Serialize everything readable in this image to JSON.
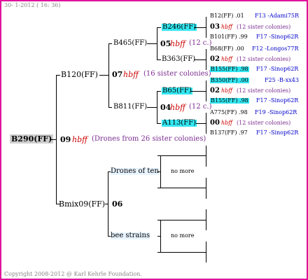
{
  "header": {
    "date": "30- 1-2012 ( 16: 36)"
  },
  "footer": {
    "copyright": "Copyright 2008-2012 @ Karl Kehrle Foundation."
  },
  "root": {
    "name": "B290(FF)",
    "num": "09",
    "hbff": "hbff",
    "desc": "(Drones from 26 sister colonies)"
  },
  "g1_top": {
    "name": "B120(FF)",
    "num": "07",
    "hbff": "hbff",
    "desc": "(16 sister colonies)"
  },
  "g1_bottom": {
    "name": "Bmix09(FF)",
    "num": "06"
  },
  "g2": {
    "a": "B465(FF)",
    "a_num": "05",
    "a_hbff": "hbff",
    "a_desc": "(12 c.)",
    "b": "B811(FF)",
    "b_num": "04",
    "b_hbff": "hbff",
    "b_desc": "(12 c.)",
    "drones_of_ten": "Drones of ten",
    "bee_strains": "bee strains",
    "no_more_1": "no more",
    "no_more_2": "no more"
  },
  "g3": {
    "a": "B246(FF)",
    "b": "B363(FF)",
    "c": "B65(FF)",
    "d": "A113(FF)"
  },
  "g4": [
    {
      "l1": "B12(FF) .01",
      "l1b": "F13 -Adami75R",
      "num": "03",
      "hbff": "hbff",
      "desc": "(12 sister colonies)",
      "l3": "B101(FF) .99",
      "l3b": "F17 -Sinop62R"
    },
    {
      "l1": "B68(FF) .00",
      "l1b": "F12 -Longos77R",
      "num": "02",
      "hbff": "hbff",
      "desc": "(12 sister colonies)",
      "l3": "B155(FF) .98",
      "l3b": "F17 -Sinop62R"
    },
    {
      "l1": "B350(FF) .00",
      "l1b": "F25 -B-xx43",
      "num": "02",
      "hbff": "hbff",
      "desc": "(12 sister colonies)",
      "l3": "B155(FF) .98",
      "l3b": "F17 -Sinop62R"
    },
    {
      "l1": "A775(FF) .98",
      "l1b": "F19 -Sinop62R",
      "num": "00",
      "hbff": "hbff",
      "desc": "(12 sister colonies)",
      "l3": "B137(FF) .97",
      "l3b": "F17 -Sinop62R"
    }
  ]
}
